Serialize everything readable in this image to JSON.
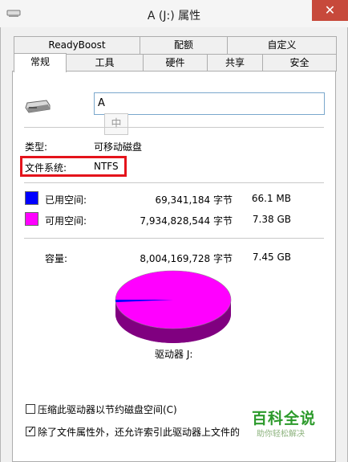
{
  "window": {
    "title": "A (J:) 属性",
    "close_glyph": "✕"
  },
  "tabs_back": [
    {
      "label": "ReadyBoost"
    },
    {
      "label": "配额"
    },
    {
      "label": "自定义"
    }
  ],
  "tabs_front": [
    {
      "label": "常规",
      "active": true
    },
    {
      "label": "工具"
    },
    {
      "label": "硬件"
    },
    {
      "label": "共享"
    },
    {
      "label": "安全"
    }
  ],
  "general": {
    "drive_icon": "usb-drive-icon",
    "name_value": "A",
    "ime_indicator": "中",
    "type_label": "类型:",
    "type_value": "可移动磁盘",
    "fs_label": "文件系统:",
    "fs_value": "NTFS",
    "used_label": "已用空间:",
    "used_bytes": "69,341,184 字节",
    "used_size": "66.1 MB",
    "used_color": "#0000ff",
    "free_label": "可用空间:",
    "free_bytes": "7,934,828,544 字节",
    "free_size": "7.38 GB",
    "free_color": "#ff00ff",
    "capacity_label": "容量:",
    "capacity_bytes": "8,004,169,728 字节",
    "capacity_size": "7.45 GB",
    "drive_label": "驱动器 J:",
    "used_fraction": 0.0087,
    "compress_label": "压缩此驱动器以节约磁盘空间(C)",
    "compress_checked": false,
    "index_label": "除了文件属性外，还允许索引此驱动器上文件的",
    "index_checked": true
  },
  "watermark": {
    "main": "百科全说",
    "sub": "助你轻松解决"
  }
}
